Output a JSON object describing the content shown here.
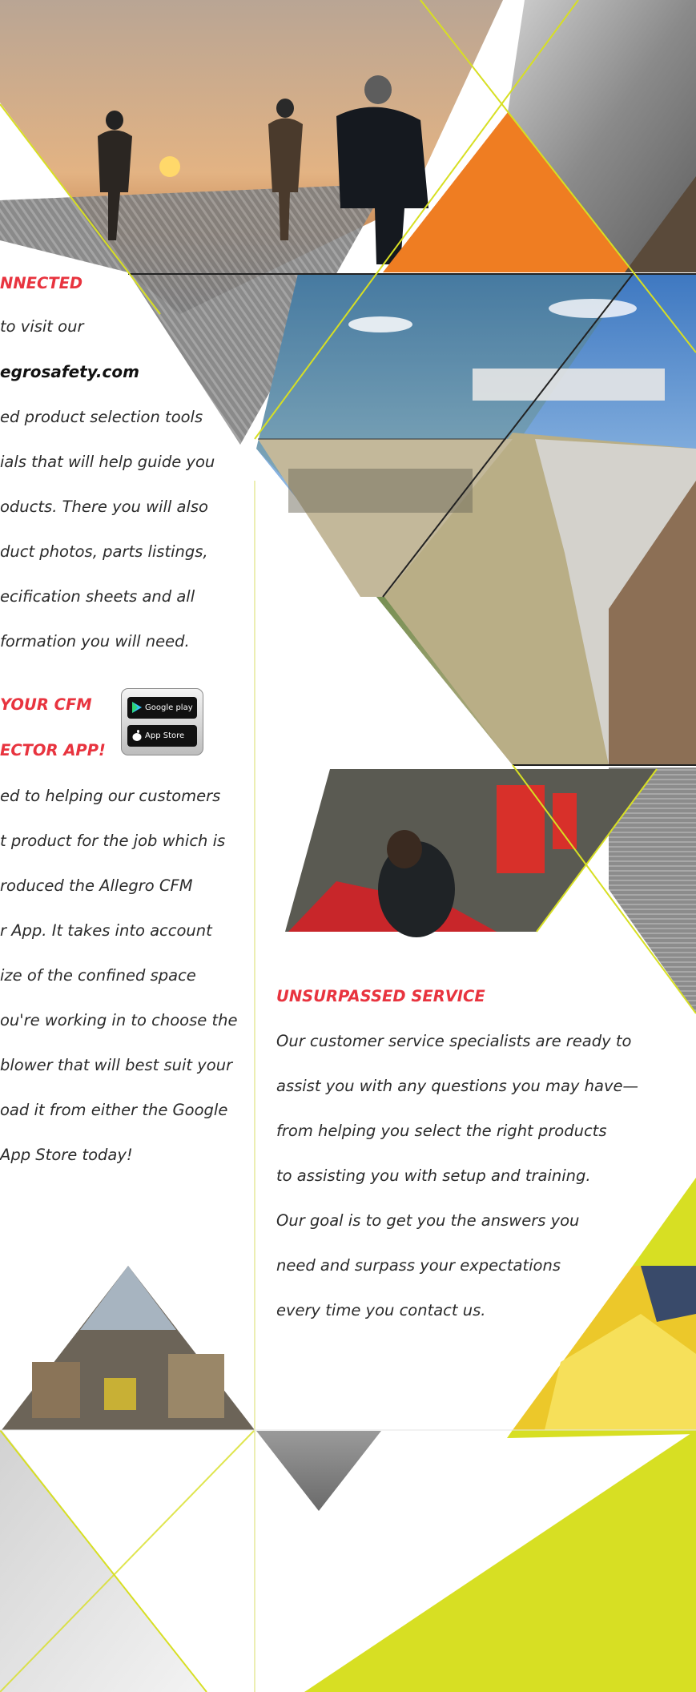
{
  "left_column": {
    "connected_heading": "NNECTED",
    "intro_lines": [
      "to visit our"
    ],
    "website": "egrosafety.com",
    "body_lines": [
      "ed product selection tools",
      "ials that will help guide you",
      "oducts. There you will also",
      "duct photos, parts listings,",
      "ecification sheets and all",
      "formation you will need."
    ],
    "app_heading_lines": [
      "YOUR CFM",
      "ECTOR APP!"
    ],
    "app_lines": [
      "ed to helping our customers",
      "t product for the job which is",
      "roduced the Allegro CFM",
      "r App. It takes into account",
      "ize of the confined space",
      "ou're working in to choose the",
      "blower that will best suit your",
      "oad it from either the Google",
      "App Store today!"
    ]
  },
  "app_badges": {
    "google_play": "Google play",
    "app_store": "App Store"
  },
  "service": {
    "heading": "UNSURPASSED SERVICE",
    "lines": [
      "Our customer service specialists are ready to",
      "assist you with any questions you may have—",
      "from helping you select the right products",
      "to assisting you with setup and training.",
      "Our goal is to get you the answers you",
      "need and surpass your expectations",
      "every time you contact us."
    ]
  },
  "colors": {
    "accent_red": "#e8343f",
    "accent_yellow": "#d7df23",
    "accent_orange": "#ef7d22",
    "gray_metal": "#8f8f8f"
  }
}
